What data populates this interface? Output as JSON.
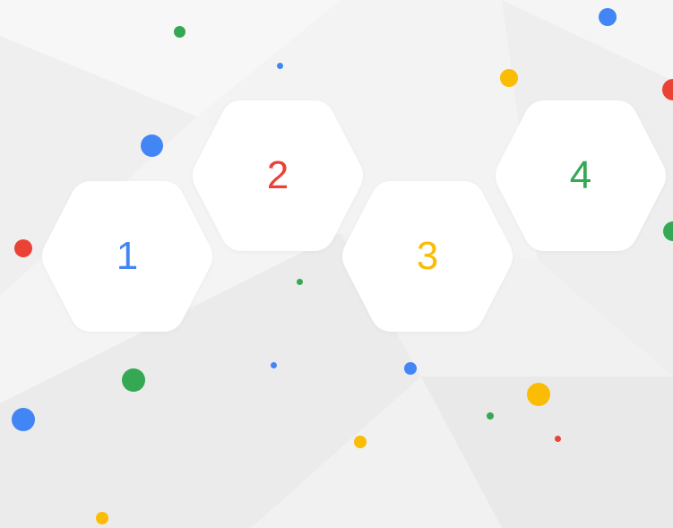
{
  "colors": {
    "blue": "#4285f4",
    "red": "#ea4335",
    "yellow": "#fbbc05",
    "green": "#34a853",
    "hex_fill": "#ffffff",
    "background": "#f2f2f2"
  },
  "hexagons": [
    {
      "label": "1",
      "color": "#4285f4"
    },
    {
      "label": "2",
      "color": "#ea4335"
    },
    {
      "label": "3",
      "color": "#fbbc05"
    },
    {
      "label": "4",
      "color": "#34a853"
    }
  ]
}
